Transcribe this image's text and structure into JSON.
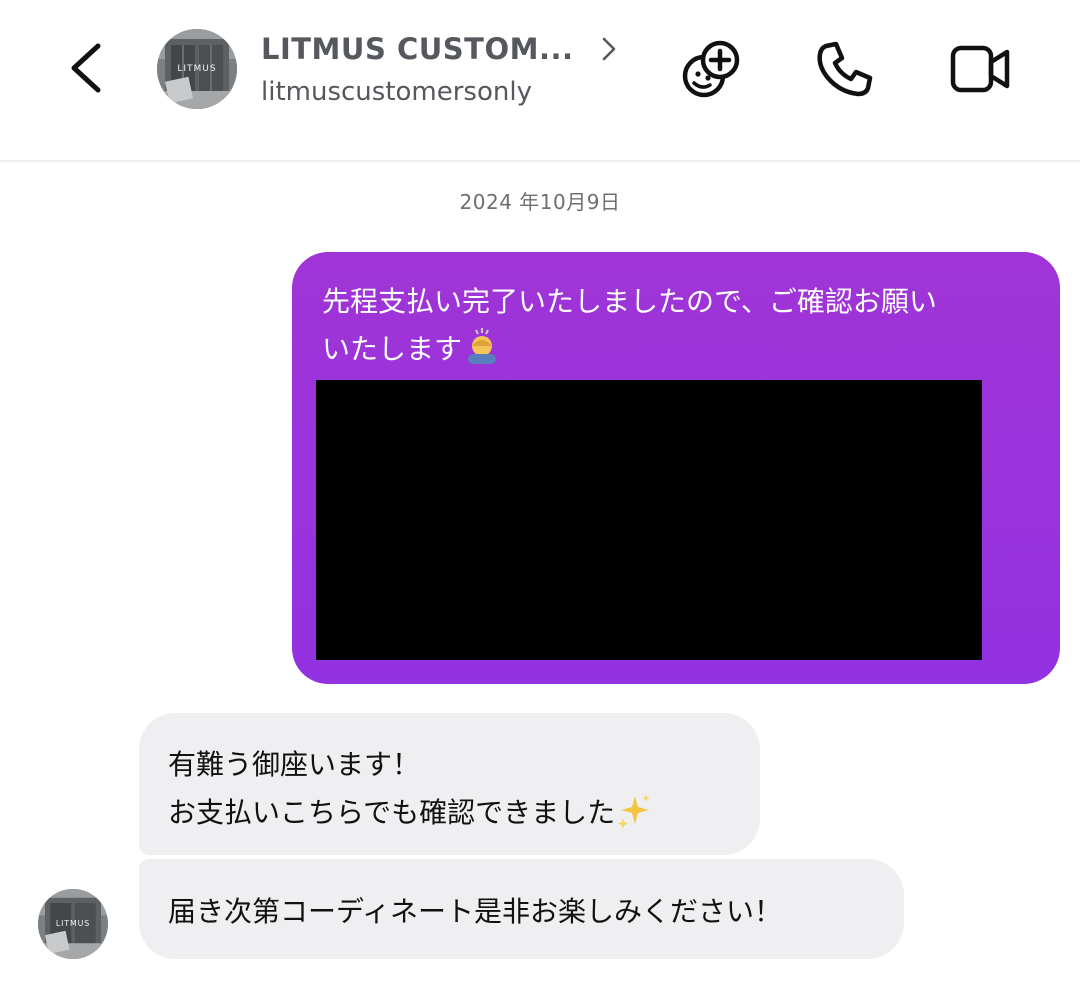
{
  "header": {
    "back_icon": "chevron-left-icon",
    "avatar_text": "LITMUS",
    "name": "LITMUS CUSTOM...",
    "username": "litmuscustomersonly",
    "chevron_icon": "chevron-right-icon",
    "actions": [
      {
        "icon": "add-effects-icon"
      },
      {
        "icon": "phone-icon"
      },
      {
        "icon": "video-camera-icon"
      }
    ]
  },
  "conversation": {
    "date": "2024 年10月9日",
    "outgoing": {
      "line1": "先程支払い完了いたしましたので、ご確認お願い",
      "line2": "いたします",
      "emoji_icon": "person-bowing-emoji",
      "attachment": "redacted-image"
    },
    "incoming": [
      {
        "line1": "有難う御座います！",
        "line2": "お支払いこちらでも確認できました",
        "emoji_icon": "sparkles-emoji"
      },
      {
        "line1": "届き次第コーディネート是非お楽しみください！"
      }
    ],
    "sender_avatar_text": "LITMUS"
  },
  "colors": {
    "outgoing_bubble_top": "#a034d6",
    "outgoing_bubble_bottom": "#9332e2",
    "incoming_bubble": "#efeff1",
    "header_text": "#55585c"
  }
}
